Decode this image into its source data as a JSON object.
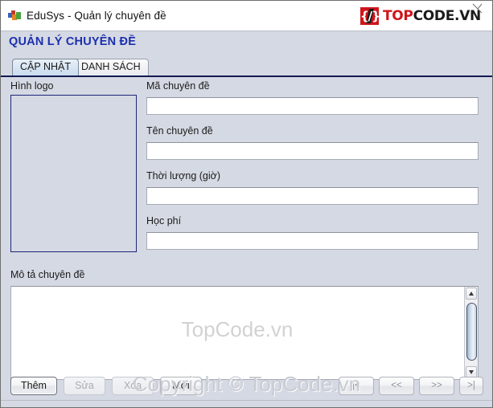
{
  "window": {
    "title": "EduSys - Quản lý chuyên đề",
    "icon": "edusys-app-icon"
  },
  "brand": {
    "mark_glyph": "{/}",
    "name_part1": "TOP",
    "name_part2": "CODE",
    "name_part3": ".VN",
    "accent_color": "#cf161c",
    "dark_color": "#1b1b1b"
  },
  "page": {
    "heading": "QUẢN LÝ CHUYÊN ĐỀ",
    "heading_color": "#1c2fae"
  },
  "tabs": [
    {
      "label": "CẬP NHẬT",
      "active": true
    },
    {
      "label": "DANH SÁCH",
      "active": false
    }
  ],
  "form": {
    "logo_label": "Hình logo",
    "logo_border_color": "#1c2577",
    "fields": [
      {
        "label": "Mã chuyên đề",
        "value": "",
        "placeholder": ""
      },
      {
        "label": "Tên chuyên đề",
        "value": "",
        "placeholder": ""
      },
      {
        "label": "Thời lượng (giờ)",
        "value": "",
        "placeholder": ""
      },
      {
        "label": "Học phí",
        "value": "",
        "placeholder": ""
      }
    ],
    "description_label": "Mô tả chuyên đề",
    "description_value": "",
    "description_watermark": "TopCode.vn"
  },
  "actions": [
    {
      "label": "Thêm",
      "state": "default"
    },
    {
      "label": "Sửa",
      "state": "disabled"
    },
    {
      "label": "Xóa",
      "state": "disabled"
    },
    {
      "label": "Mới",
      "state": "enabled"
    }
  ],
  "navigation": [
    {
      "label": "|<",
      "name": "first"
    },
    {
      "label": "<<",
      "name": "previous"
    },
    {
      "label": ">>",
      "name": "next"
    },
    {
      "label": ">|",
      "name": "last"
    }
  ],
  "watermark": {
    "footer": "Copyright © TopCode.vn"
  }
}
